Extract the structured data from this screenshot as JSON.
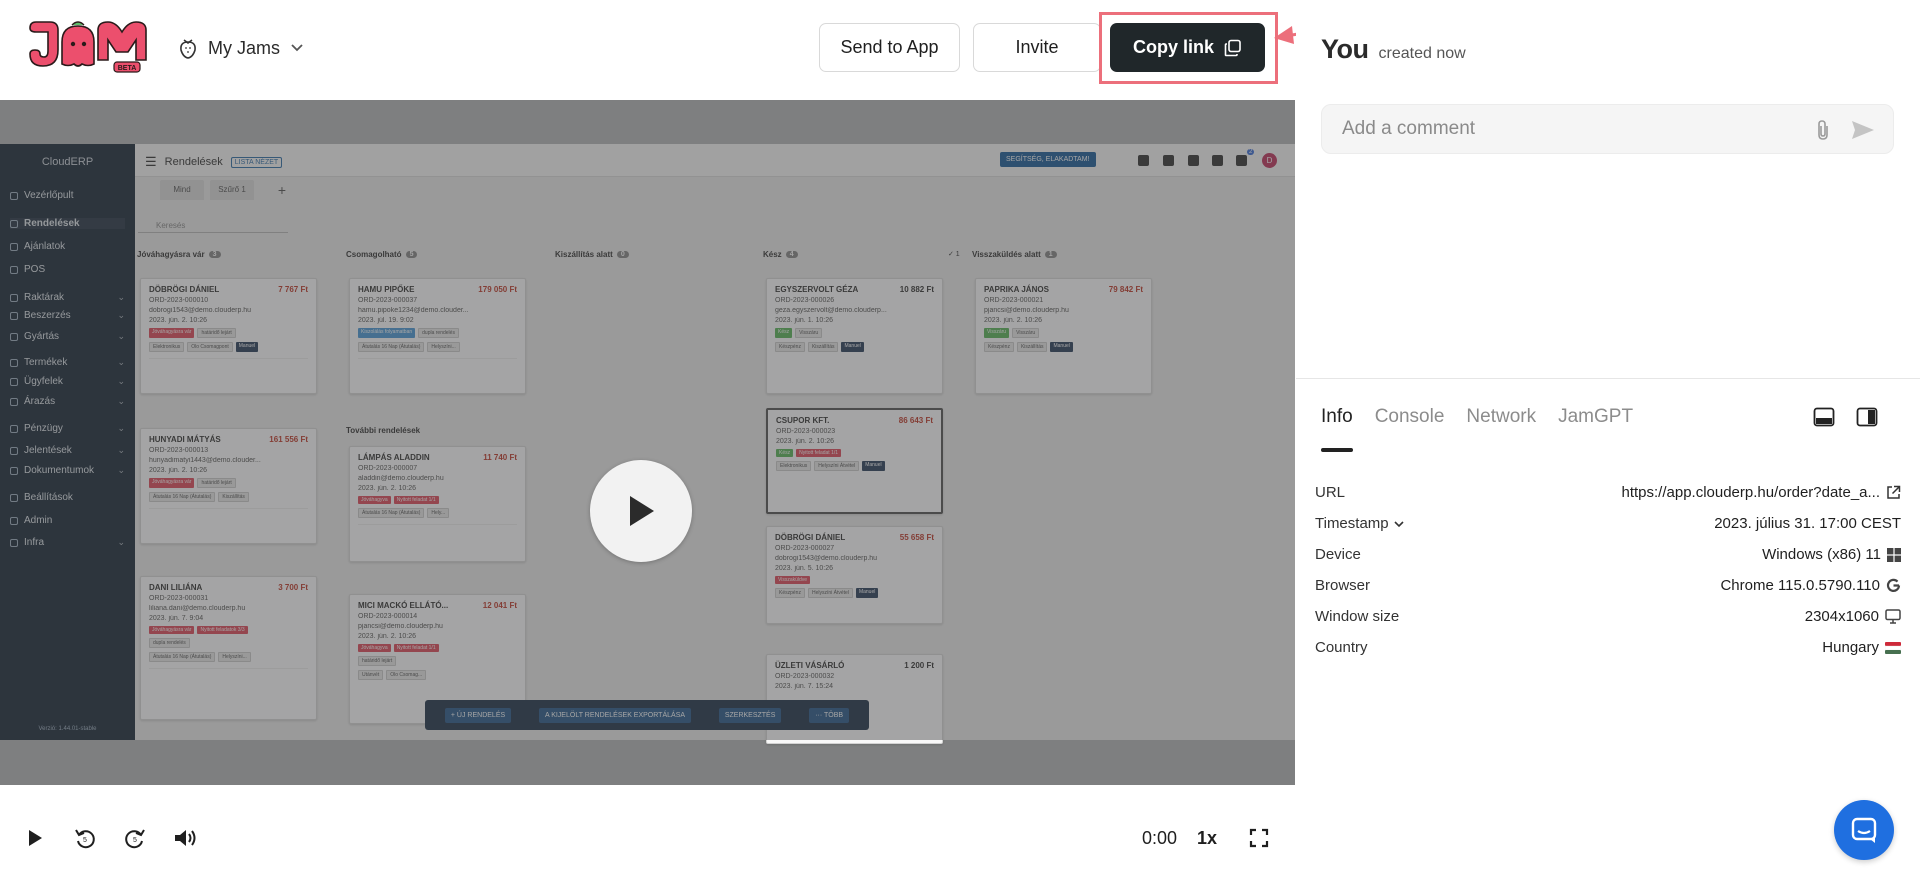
{
  "header": {
    "logo_alt": "JAM BETA",
    "logo_badge": "BETA",
    "my_jams_label": "My Jams",
    "send_to_app_label": "Send to App",
    "invite_label": "Invite",
    "copy_link_label": "Copy link"
  },
  "recording": {
    "app_brand": "CloudERP",
    "page_title": "Rendelések",
    "view_badge": "LISTA NÉZET",
    "help_button": "SEGÍTSÉG, ELAKADTAM!",
    "avatar_letter": "D",
    "notification_count": "2",
    "filter_tabs": [
      "Mind",
      "Szűrő 1"
    ],
    "search_placeholder": "Keresés",
    "version": "Verzió: 1.44.01-stable",
    "sidebar": [
      {
        "label": "Vezérlőpult",
        "chev": ""
      },
      {
        "label": "Rendelések",
        "chev": ""
      },
      {
        "label": "Ajánlatok",
        "chev": ""
      },
      {
        "label": "POS",
        "chev": ""
      },
      {
        "label": "Raktárak",
        "chev": "⌄"
      },
      {
        "label": "Beszerzés",
        "chev": "⌄"
      },
      {
        "label": "Gyártás",
        "chev": "⌄"
      },
      {
        "label": "Termékek",
        "chev": "⌄"
      },
      {
        "label": "Ügyfelek",
        "chev": "⌄"
      },
      {
        "label": "Árazás",
        "chev": "⌄"
      },
      {
        "label": "Pénzügy",
        "chev": "⌄"
      },
      {
        "label": "Jelentések",
        "chev": "⌄"
      },
      {
        "label": "Dokumentumok",
        "chev": "⌄"
      },
      {
        "label": "Beállítások",
        "chev": ""
      },
      {
        "label": "Admin",
        "chev": ""
      },
      {
        "label": "Infra",
        "chev": "⌄"
      }
    ],
    "columns": [
      {
        "title": "Jóváhagyásra vár",
        "count": "3"
      },
      {
        "title": "Csomagolható",
        "count": "5"
      },
      {
        "title": "Kiszállítás alatt",
        "count": "0"
      },
      {
        "title": "Kész",
        "count": "4"
      },
      {
        "title": "Visszaküldés alatt",
        "count": "1"
      }
    ],
    "further_orders_label": "További rendelések",
    "done_extra": "✓ 1",
    "cards": [
      {
        "name": "DÖBRÖGI DÁNIEL",
        "price": "7 767 Ft",
        "id": "ORD-2023-000010",
        "email": "dobrogi1543@demo.clouderp.hu",
        "date": "2023. jún. 2. 10:26",
        "tags": [
          "Jóváhagyásra vár",
          "határidő lejárt"
        ],
        "tags2": [
          "Elektronikus",
          "Olo Csomagpont",
          "Manuel"
        ]
      },
      {
        "name": "HUNYADI MÁTYÁS",
        "price": "161 556 Ft",
        "id": "ORD-2023-000013",
        "email": "hunyadimatyi1443@demo.clouder...",
        "date": "2023. jún. 2. 10:26",
        "tags": [
          "Jóváhagyásra vár",
          "határidő lejárt"
        ],
        "tags2": [
          "Átutalás 16 Nap (Átutalás)",
          "Kiszállítás"
        ]
      },
      {
        "name": "DANI LILIÁNA",
        "price": "3 700 Ft",
        "id": "ORD-2023-000031",
        "email": "liliana.dani@demo.clouderp.hu",
        "date": "2023. jún. 7. 9:04",
        "tags": [
          "Jóváhagyásra vár",
          "Nyitott feladatok 3/3"
        ],
        "tags2": [
          "dupla rendelés"
        ],
        "tags3": [
          "Átutalás 16 Nap (Átutalás)",
          "Helyszíni..."
        ]
      },
      {
        "name": "HAMU PIPŐKE",
        "price": "179 050 Ft",
        "id": "ORD-2023-000037",
        "email": "hamu.pipoke1234@demo.clouder...",
        "date": "2023. júl. 19. 9:02",
        "tags": [
          "Kiszolálás folyamatban",
          "dupla rendelés"
        ],
        "tags2": [
          "Átutalás 16 Nap (Átutalás)",
          "Helyszíni..."
        ]
      },
      {
        "name": "LÁMPÁS ALADDIN",
        "price": "11 740 Ft",
        "id": "ORD-2023-000007",
        "email": "aladdin@demo.clouderp.hu",
        "date": "2023. jún. 2. 10:26",
        "tags": [
          "Jóváhagyva",
          "Nyitott feladat 1/1"
        ],
        "tags2": [
          "Átutalás 16 Nap (Átutalás)",
          "Hely..."
        ]
      },
      {
        "name": "MICI MACKÓ ELLÁTÓ...",
        "price": "12 041 Ft",
        "id": "ORD-2023-000014",
        "email": "pjancsi@demo.clouderp.hu",
        "date": "2023. jún. 2. 10:26",
        "tags": [
          "Jóváhagyva",
          "Nyitott feladat 1/1"
        ],
        "tags2": [
          "határidő lejárt"
        ],
        "tags3": [
          "Utánvét",
          "Olo Csomag..."
        ]
      },
      {
        "name": "EGYSZERVOLT GÉZA",
        "price": "10 882 Ft",
        "id": "ORD-2023-000026",
        "email": "geza.egyszervolt@demo.clouderp...",
        "date": "2023. jún. 1. 10:26",
        "tags": [
          "Kész",
          "Visszáru"
        ],
        "tags2": [
          "Készpénz",
          "Kiszállítás",
          "Manuel"
        ]
      },
      {
        "name": "CSUPOR KFT.",
        "price": "86 643 Ft",
        "id": "ORD-2023-000023",
        "email": "",
        "date": "2023. jún. 2. 10:26",
        "tags": [
          "Kész",
          "Nyitott feladat 1/1"
        ],
        "tags2": [
          "Elektronikus",
          "Helyszíni Átvétel",
          "Manuel"
        ]
      },
      {
        "name": "DÖBRÖGI DÁNIEL",
        "price": "55 658 Ft",
        "id": "ORD-2023-000027",
        "email": "dobrogi1543@demo.clouderp.hu",
        "date": "2023. jún. 5. 10:26",
        "tags": [
          "Visszaküldve"
        ],
        "tags2": [
          "Készpénz",
          "Helyszíni Átvétel",
          "Manuel"
        ]
      },
      {
        "name": "ÜZLETI VÁSÁRLÓ",
        "price": "1 200 Ft",
        "id": "ORD-2023-000032",
        "email": "",
        "date": "2023. jún. 7. 15:24",
        "tags": [],
        "tags2": []
      },
      {
        "name": "PAPRIKA JÁNOS",
        "price": "79 842 Ft",
        "id": "ORD-2023-000021",
        "email": "pjancsi@demo.clouderp.hu",
        "date": "2023. jún. 2. 10:26",
        "tags": [
          "Visszáru",
          "Visszáru"
        ],
        "tags2": [
          "Készpénz",
          "Kiszállítás",
          "Manuel"
        ]
      }
    ],
    "bottom_actions": [
      "+ ÚJ RENDELÉS",
      "A KIJELÖLT RENDELÉSEK EXPORTÁLÁSA",
      "SZERKESZTÉS",
      "··· TÖBB"
    ]
  },
  "player": {
    "time": "0:00",
    "speed": "1x"
  },
  "sidebar": {
    "author": "You",
    "created": "created now",
    "comment_placeholder": "Add a comment",
    "tabs": [
      "Info",
      "Console",
      "Network",
      "JamGPT"
    ],
    "info": [
      {
        "key": "URL",
        "value": "https://app.clouderp.hu/order?date_a..."
      },
      {
        "key": "Timestamp",
        "value": "2023. július 31. 17:00 CEST"
      },
      {
        "key": "Device",
        "value": "Windows (x86) 11"
      },
      {
        "key": "Browser",
        "value": "Chrome 115.0.5790.110"
      },
      {
        "key": "Window size",
        "value": "2304x1060"
      },
      {
        "key": "Country",
        "value": "Hungary"
      }
    ]
  },
  "colors": {
    "accent_dark": "#20272a",
    "highlight": "#ec6f7b",
    "logo_pink": "#ec4f6d",
    "chat": "#1f6fe0"
  }
}
